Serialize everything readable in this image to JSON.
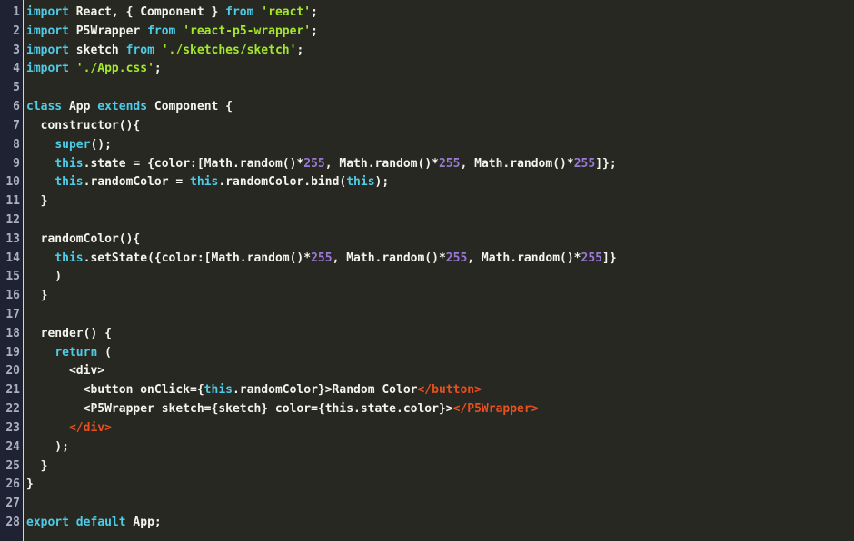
{
  "editor": {
    "language": "jsx",
    "theme": "monokai-dark",
    "filename": "App.js",
    "total_lines": 28,
    "colors": {
      "background": "#272822",
      "gutter_background": "#1e2233",
      "gutter_separator": "#cfd3dd",
      "line_number": "#a9b1c2",
      "default_text": "#f4f4ef",
      "keyword": "#4ecbe6",
      "string": "#a4e82c",
      "number": "#9b79d6",
      "jsx_closing_tag": "#e8501f"
    },
    "line_numbers": [
      "1",
      "2",
      "3",
      "4",
      "5",
      "6",
      "7",
      "8",
      "9",
      "10",
      "11",
      "12",
      "13",
      "14",
      "15",
      "16",
      "17",
      "18",
      "19",
      "20",
      "21",
      "22",
      "23",
      "24",
      "25",
      "26",
      "27",
      "28"
    ],
    "lines": [
      {
        "n": 1,
        "tokens": [
          {
            "t": "import",
            "c": "kw"
          },
          {
            "t": " React, { Component } ",
            "c": "def"
          },
          {
            "t": "from",
            "c": "kw"
          },
          {
            "t": " ",
            "c": "def"
          },
          {
            "t": "'react'",
            "c": "str"
          },
          {
            "t": ";",
            "c": "def"
          }
        ]
      },
      {
        "n": 2,
        "tokens": [
          {
            "t": "import",
            "c": "kw"
          },
          {
            "t": " P5Wrapper ",
            "c": "def"
          },
          {
            "t": "from",
            "c": "kw"
          },
          {
            "t": " ",
            "c": "def"
          },
          {
            "t": "'react-p5-wrapper'",
            "c": "str"
          },
          {
            "t": ";",
            "c": "def"
          }
        ]
      },
      {
        "n": 3,
        "tokens": [
          {
            "t": "import",
            "c": "kw"
          },
          {
            "t": " sketch ",
            "c": "def"
          },
          {
            "t": "from",
            "c": "kw"
          },
          {
            "t": " ",
            "c": "def"
          },
          {
            "t": "'./sketches/sketch'",
            "c": "str"
          },
          {
            "t": ";",
            "c": "def"
          }
        ]
      },
      {
        "n": 4,
        "tokens": [
          {
            "t": "import",
            "c": "kw"
          },
          {
            "t": " ",
            "c": "def"
          },
          {
            "t": "'./App.css'",
            "c": "str"
          },
          {
            "t": ";",
            "c": "def"
          }
        ]
      },
      {
        "n": 5,
        "tokens": []
      },
      {
        "n": 6,
        "tokens": [
          {
            "t": "class",
            "c": "kw"
          },
          {
            "t": " App ",
            "c": "def"
          },
          {
            "t": "extends",
            "c": "kw"
          },
          {
            "t": " Component {",
            "c": "def"
          }
        ]
      },
      {
        "n": 7,
        "tokens": [
          {
            "t": "  constructor(){",
            "c": "def"
          }
        ]
      },
      {
        "n": 8,
        "tokens": [
          {
            "t": "    ",
            "c": "def"
          },
          {
            "t": "super",
            "c": "kw"
          },
          {
            "t": "();",
            "c": "def"
          }
        ]
      },
      {
        "n": 9,
        "tokens": [
          {
            "t": "    ",
            "c": "def"
          },
          {
            "t": "this",
            "c": "this"
          },
          {
            "t": ".state = {color:[Math.random()*",
            "c": "def"
          },
          {
            "t": "255",
            "c": "num"
          },
          {
            "t": ", Math.random()*",
            "c": "def"
          },
          {
            "t": "255",
            "c": "num"
          },
          {
            "t": ", Math.random()*",
            "c": "def"
          },
          {
            "t": "255",
            "c": "num"
          },
          {
            "t": "]};",
            "c": "def"
          }
        ]
      },
      {
        "n": 10,
        "tokens": [
          {
            "t": "    ",
            "c": "def"
          },
          {
            "t": "this",
            "c": "this"
          },
          {
            "t": ".randomColor = ",
            "c": "def"
          },
          {
            "t": "this",
            "c": "this"
          },
          {
            "t": ".randomColor.bind(",
            "c": "def"
          },
          {
            "t": "this",
            "c": "this"
          },
          {
            "t": ");",
            "c": "def"
          }
        ]
      },
      {
        "n": 11,
        "tokens": [
          {
            "t": "  }",
            "c": "def"
          }
        ]
      },
      {
        "n": 12,
        "tokens": []
      },
      {
        "n": 13,
        "tokens": [
          {
            "t": "  randomColor(){",
            "c": "def"
          }
        ]
      },
      {
        "n": 14,
        "tokens": [
          {
            "t": "    ",
            "c": "def"
          },
          {
            "t": "this",
            "c": "this"
          },
          {
            "t": ".setState({color:[Math.random()*",
            "c": "def"
          },
          {
            "t": "255",
            "c": "num"
          },
          {
            "t": ", Math.random()*",
            "c": "def"
          },
          {
            "t": "255",
            "c": "num"
          },
          {
            "t": ", Math.random()*",
            "c": "def"
          },
          {
            "t": "255",
            "c": "num"
          },
          {
            "t": "]}",
            "c": "def"
          }
        ]
      },
      {
        "n": 15,
        "tokens": [
          {
            "t": "    )",
            "c": "def"
          }
        ]
      },
      {
        "n": 16,
        "tokens": [
          {
            "t": "  }",
            "c": "def"
          }
        ]
      },
      {
        "n": 17,
        "tokens": []
      },
      {
        "n": 18,
        "tokens": [
          {
            "t": "  render() {",
            "c": "def"
          }
        ]
      },
      {
        "n": 19,
        "tokens": [
          {
            "t": "    ",
            "c": "def"
          },
          {
            "t": "return",
            "c": "kw"
          },
          {
            "t": " (",
            "c": "def"
          }
        ]
      },
      {
        "n": 20,
        "tokens": [
          {
            "t": "      <div>",
            "c": "def"
          }
        ]
      },
      {
        "n": 21,
        "tokens": [
          {
            "t": "        <button onClick={",
            "c": "def"
          },
          {
            "t": "this",
            "c": "this"
          },
          {
            "t": ".randomColor}>Random Color",
            "c": "def"
          },
          {
            "t": "</button>",
            "c": "tag"
          }
        ]
      },
      {
        "n": 22,
        "tokens": [
          {
            "t": "        <P5Wrapper sketch={sketch} color={this.state.color}>",
            "c": "def"
          },
          {
            "t": "</P5Wrapper>",
            "c": "tag"
          }
        ]
      },
      {
        "n": 23,
        "tokens": [
          {
            "t": "      ",
            "c": "def"
          },
          {
            "t": "</div>",
            "c": "tag"
          }
        ]
      },
      {
        "n": 24,
        "tokens": [
          {
            "t": "    );",
            "c": "def"
          }
        ]
      },
      {
        "n": 25,
        "tokens": [
          {
            "t": "  }",
            "c": "def"
          }
        ]
      },
      {
        "n": 26,
        "tokens": [
          {
            "t": "}",
            "c": "def"
          }
        ]
      },
      {
        "n": 27,
        "tokens": []
      },
      {
        "n": 28,
        "tokens": [
          {
            "t": "export",
            "c": "kw"
          },
          {
            "t": " ",
            "c": "def"
          },
          {
            "t": "default",
            "c": "kw"
          },
          {
            "t": " App;",
            "c": "def"
          }
        ]
      }
    ]
  }
}
